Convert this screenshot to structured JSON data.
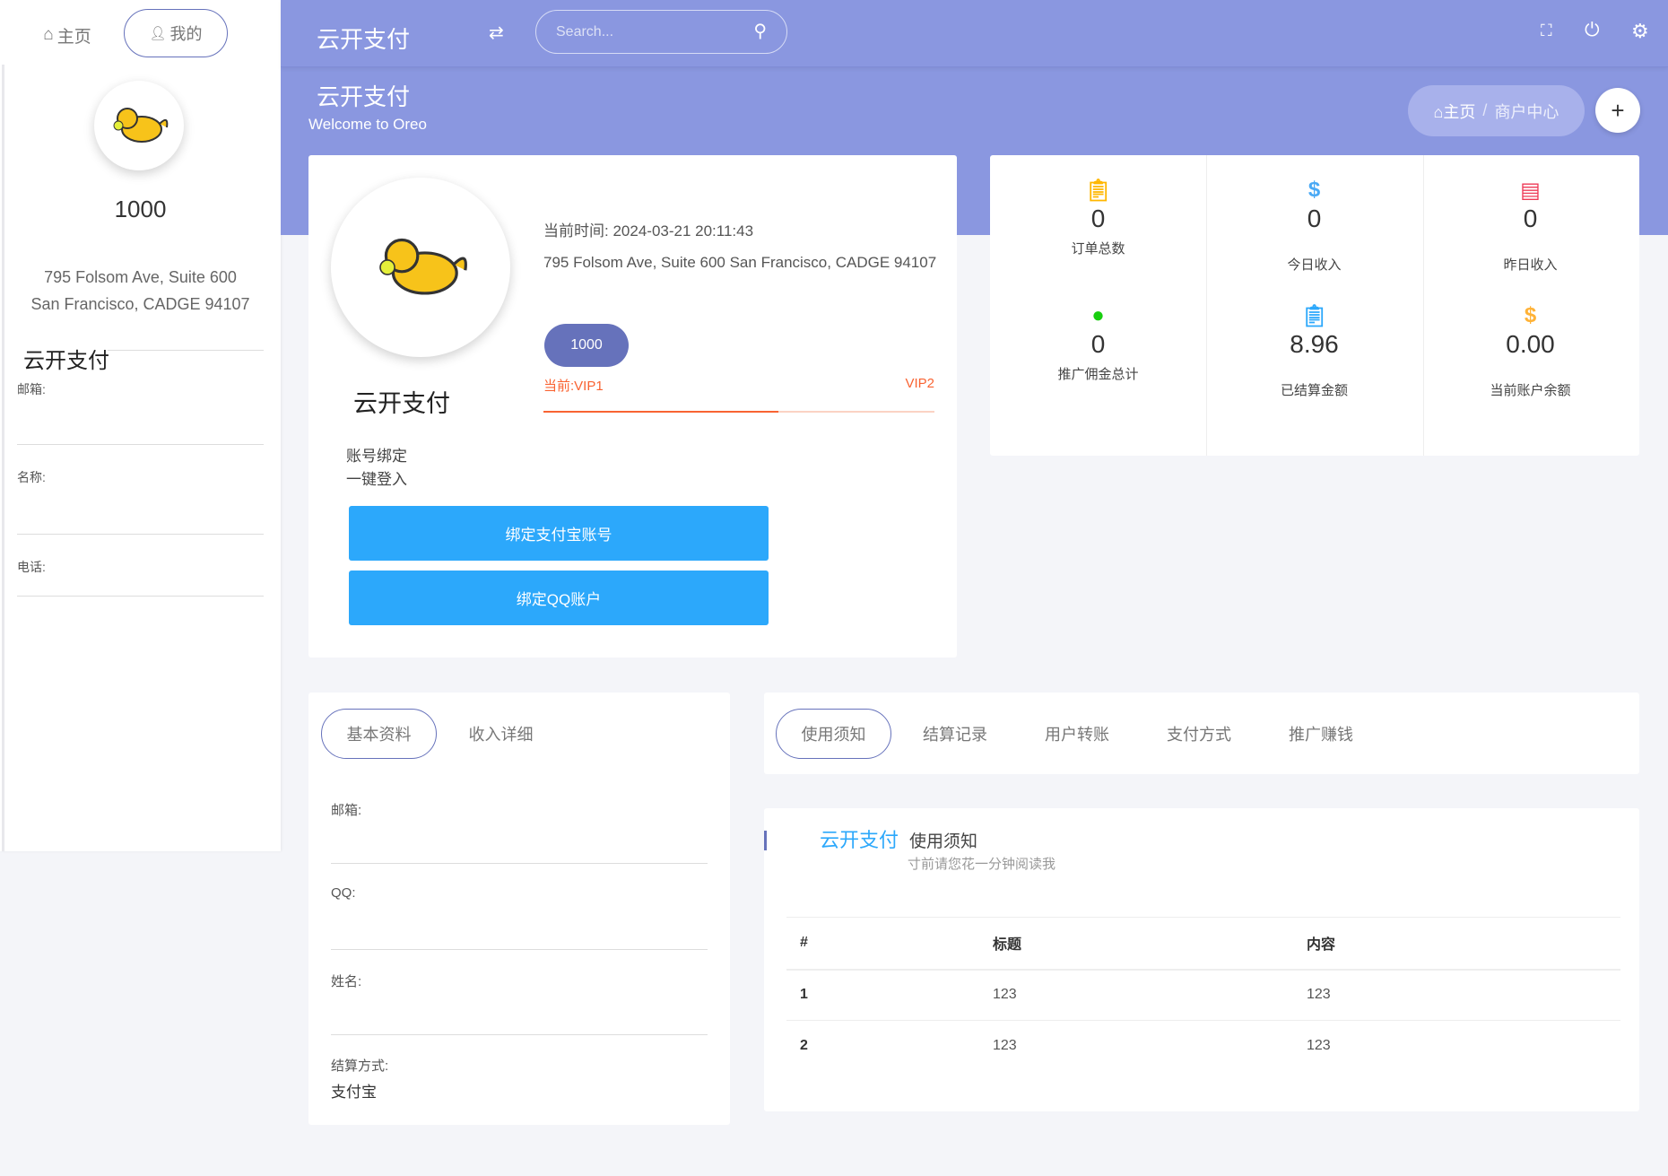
{
  "sidebar": {
    "tabs": [
      {
        "label": "主页",
        "icon": "home-icon"
      },
      {
        "label": "我的",
        "icon": "user-icon"
      }
    ],
    "balance": "1000",
    "address_line1": "795 Folsom Ave, Suite 600",
    "address_line2": "San Francisco, CADGE 94107",
    "title": "云开支付",
    "fields": [
      {
        "label": "邮箱:"
      },
      {
        "label": "名称:"
      },
      {
        "label": "电话:"
      }
    ]
  },
  "header": {
    "brand": "云开支付",
    "search_placeholder": "Search...",
    "page_title": "云开支付",
    "subtitle": "Welcome to Oreo",
    "breadcrumb": {
      "home": "主页",
      "sep": "/",
      "current": "商户中心"
    },
    "accent": "#8a97e0"
  },
  "profile": {
    "name": "云开支付",
    "time_label": "当前时间:",
    "time_value": "2024-03-21 20:11:43",
    "address": "795 Folsom Ave, Suite 600 San Francisco, CADGE 94107",
    "badge": "1000",
    "vip_current": "当前:VIP1",
    "vip_next": "VIP2",
    "vip_progress_percent": 60,
    "bind_title": "账号绑定",
    "bind_sub": "一键登入",
    "bind_alipay": "绑定支付宝账号",
    "bind_qq": "绑定QQ账户"
  },
  "stats": [
    {
      "value": "0",
      "label": "订单总数",
      "icon": "clipboard-icon",
      "color": "#ffb700"
    },
    {
      "value": "0",
      "label": "今日收入",
      "icon": "dollar-icon",
      "color": "#49a9f5"
    },
    {
      "value": "0",
      "label": "昨日收入",
      "icon": "message-icon",
      "color": "#ee3a57"
    },
    {
      "value": "0",
      "label": "推广佣金总计",
      "icon": "user-icon",
      "color": "#18ce0f"
    },
    {
      "value": "8.96",
      "label": "已结算金额",
      "icon": "clipboard-icon",
      "color": "#2ca8fb"
    },
    {
      "value": "0.00",
      "label": "当前账户余额",
      "icon": "dollar-icon",
      "color": "#ffb236"
    }
  ],
  "info_tabs": {
    "tabs": [
      "基本资料",
      "收入详细"
    ],
    "fields": [
      {
        "label": "邮箱:",
        "value": ""
      },
      {
        "label": "QQ:",
        "value": ""
      },
      {
        "label": "姓名:",
        "value": ""
      },
      {
        "label": "结算方式:",
        "value": "支付宝"
      }
    ]
  },
  "notice_tabs": [
    "使用须知",
    "结算记录",
    "用户转账",
    "支付方式",
    "推广赚钱"
  ],
  "notice": {
    "brand": "云开支付",
    "title": "使用须知",
    "subtitle": "寸前请您花一分钟阅读我",
    "columns": [
      "#",
      "标题",
      "内容"
    ],
    "rows": [
      [
        "1",
        "123",
        "123"
      ],
      [
        "2",
        "123",
        "123"
      ]
    ]
  }
}
